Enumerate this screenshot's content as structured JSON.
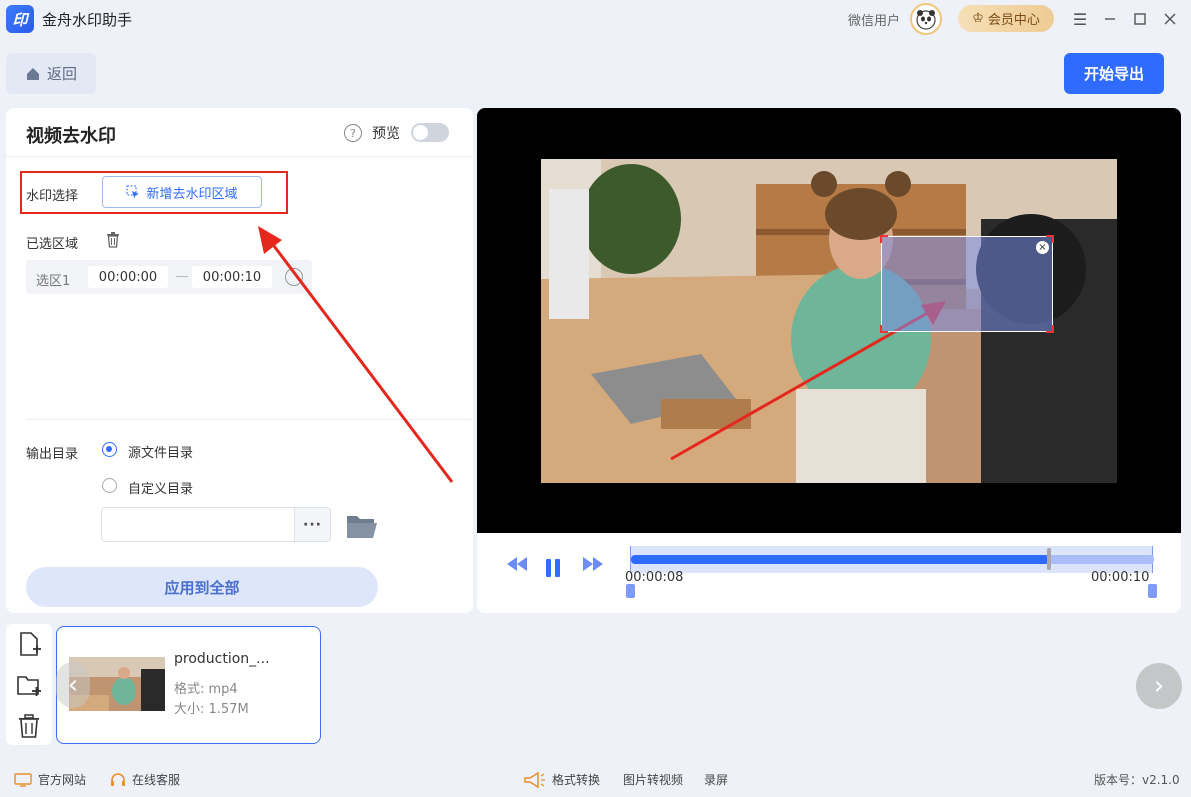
{
  "app": {
    "title": "金舟水印助手",
    "logo_text": "印",
    "user_name": "微信用户",
    "vip_label": "会员中心"
  },
  "toolbar": {
    "back_label": "返回",
    "export_label": "开始导出"
  },
  "panel": {
    "title": "视频去水印",
    "preview_label": "预览",
    "preview_enabled": false,
    "watermark_label": "水印选择",
    "add_region_label": "新增去水印区域",
    "selected_label": "已选区域",
    "regions": [
      {
        "name": "选区1",
        "start": "00:00:00",
        "end": "00:00:10"
      }
    ],
    "output_label": "输出目录",
    "output_options": [
      {
        "label": "源文件目录",
        "selected": true
      },
      {
        "label": "自定义目录",
        "selected": false
      }
    ],
    "path_value": "",
    "browse_label": "···",
    "apply_label": "应用到全部"
  },
  "player": {
    "current_time": "00:00:08",
    "end_time": "00:00:10",
    "progress": 0.8,
    "close_glyph": "×"
  },
  "file": {
    "name": "production_...",
    "format": "格式: mp4",
    "size": "大小: 1.57M"
  },
  "footer": {
    "website": "官方网站",
    "support": "在线客服",
    "convert": "格式转换",
    "img2video": "图片转视频",
    "record": "录屏",
    "version": "版本号：v2.1.0"
  },
  "colors": {
    "accent": "#2f6bff",
    "highlight_red": "#e4281e",
    "vip_gold": "#eecb92"
  }
}
